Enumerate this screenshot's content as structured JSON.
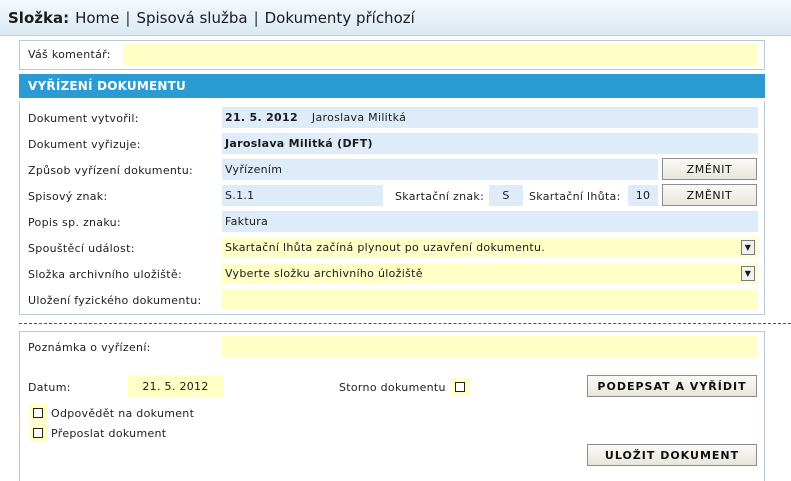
{
  "breadcrumb": {
    "root": "Složka:",
    "items": [
      "Home",
      "Spisová služba",
      "Dokumenty příchozí"
    ],
    "separator": "|"
  },
  "comment": {
    "label": "Váš komentář:",
    "value": ""
  },
  "section": {
    "title": "VYŘÍZENÍ DOKUMENTU"
  },
  "main": {
    "created_label": "Dokument vytvořil:",
    "created_date": "21. 5. 2012",
    "created_by": "Jaroslava Militká",
    "handler_label": "Dokument vyřizuje:",
    "handler_value": "Jaroslava Militká (DFT)",
    "method_label": "Způsob vyřízení dokumentu:",
    "method_value": "Vyřízením",
    "method_button": "ZMĚNIT",
    "file_mark_label": "Spisový znak:",
    "file_mark_value": "S.1.1",
    "shred_mark_label": "Skartační znak:",
    "shred_mark_value": "S",
    "shred_period_label": "Skartační lhůta:",
    "shred_period_value": "10",
    "shred_button": "ZMĚNIT",
    "file_desc_label": "Popis sp. znaku:",
    "file_desc_value": "Faktura",
    "trigger_label": "Spouštěcí událost:",
    "trigger_value": "Skartační lhůta začíná plynout po uzavření dokumentu.",
    "archive_label": "Složka archivního uložiště:",
    "archive_value": "Vyberte složku archivního úložiště",
    "physical_label": "Uložení fyzického dokumentu:",
    "physical_value": ""
  },
  "bottom": {
    "note_label": "Poznámka o vyřízení:",
    "note_value": "",
    "date_label": "Datum:",
    "date_value": "21. 5. 2012",
    "storno_label": "Storno dokumentu",
    "sign_button": "PODEPSAT A VYŘÍDIT",
    "reply_label": "Odpovědět na dokument",
    "forward_label": "Přeposlat dokument",
    "save_button": "ULOŽIT DOKUMENT"
  }
}
